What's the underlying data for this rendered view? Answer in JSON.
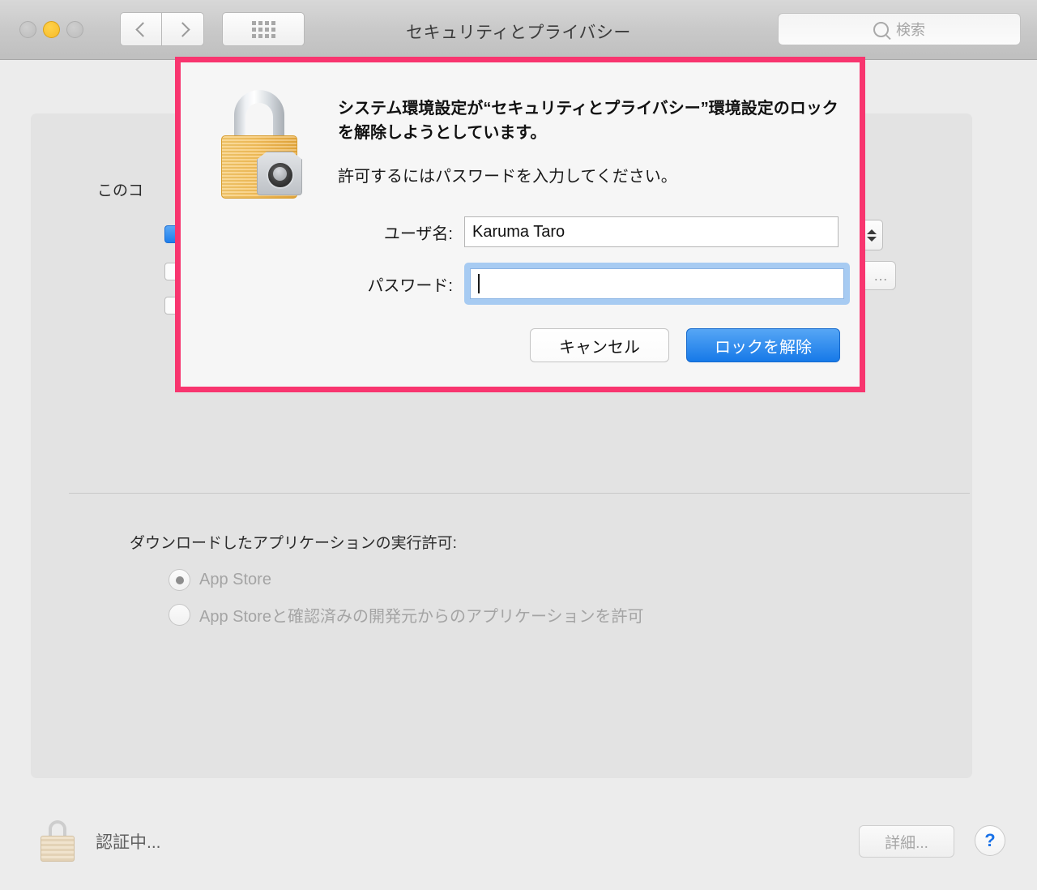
{
  "window": {
    "title": "セキュリティとプライバシー",
    "traffic_lights": [
      {
        "name": "close",
        "state": "disabled"
      },
      {
        "name": "minimize",
        "state": "amber"
      },
      {
        "name": "zoom",
        "state": "disabled"
      }
    ],
    "nav": {
      "back": "‹",
      "forward": "›"
    },
    "grid_button": "show-all",
    "search": {
      "placeholder": "検索",
      "value": ""
    }
  },
  "background": {
    "description_partial": "このコ",
    "right_button_label": "…"
  },
  "gatekeeper": {
    "label": "ダウンロードしたアプリケーションの実行許可:",
    "options": [
      {
        "label": "App Store",
        "selected": true,
        "disabled": true
      },
      {
        "label": "App Storeと確認済みの開発元からのアプリケーションを許可",
        "selected": false,
        "disabled": true
      }
    ]
  },
  "bottom_bar": {
    "lock_icon": "lock-closed-icon",
    "status_text": "認証中...",
    "advanced_button": "詳細...",
    "help_button": "?"
  },
  "auth_sheet": {
    "icon": "padlock-icon",
    "heading": "システム環境設定が“セキュリティとプライバシー”環境設定のロックを解除しようとしています。",
    "subheading": "許可するにはパスワードを入力してください。",
    "fields": [
      {
        "label": "ユーザ名:",
        "value": "Karuma Taro",
        "type": "text"
      },
      {
        "label": "パスワード:",
        "value": "",
        "type": "password",
        "focused": true
      }
    ],
    "cancel_button": "キャンセル",
    "unlock_button": "ロックを解除",
    "highlight_color": "#f8356f"
  }
}
